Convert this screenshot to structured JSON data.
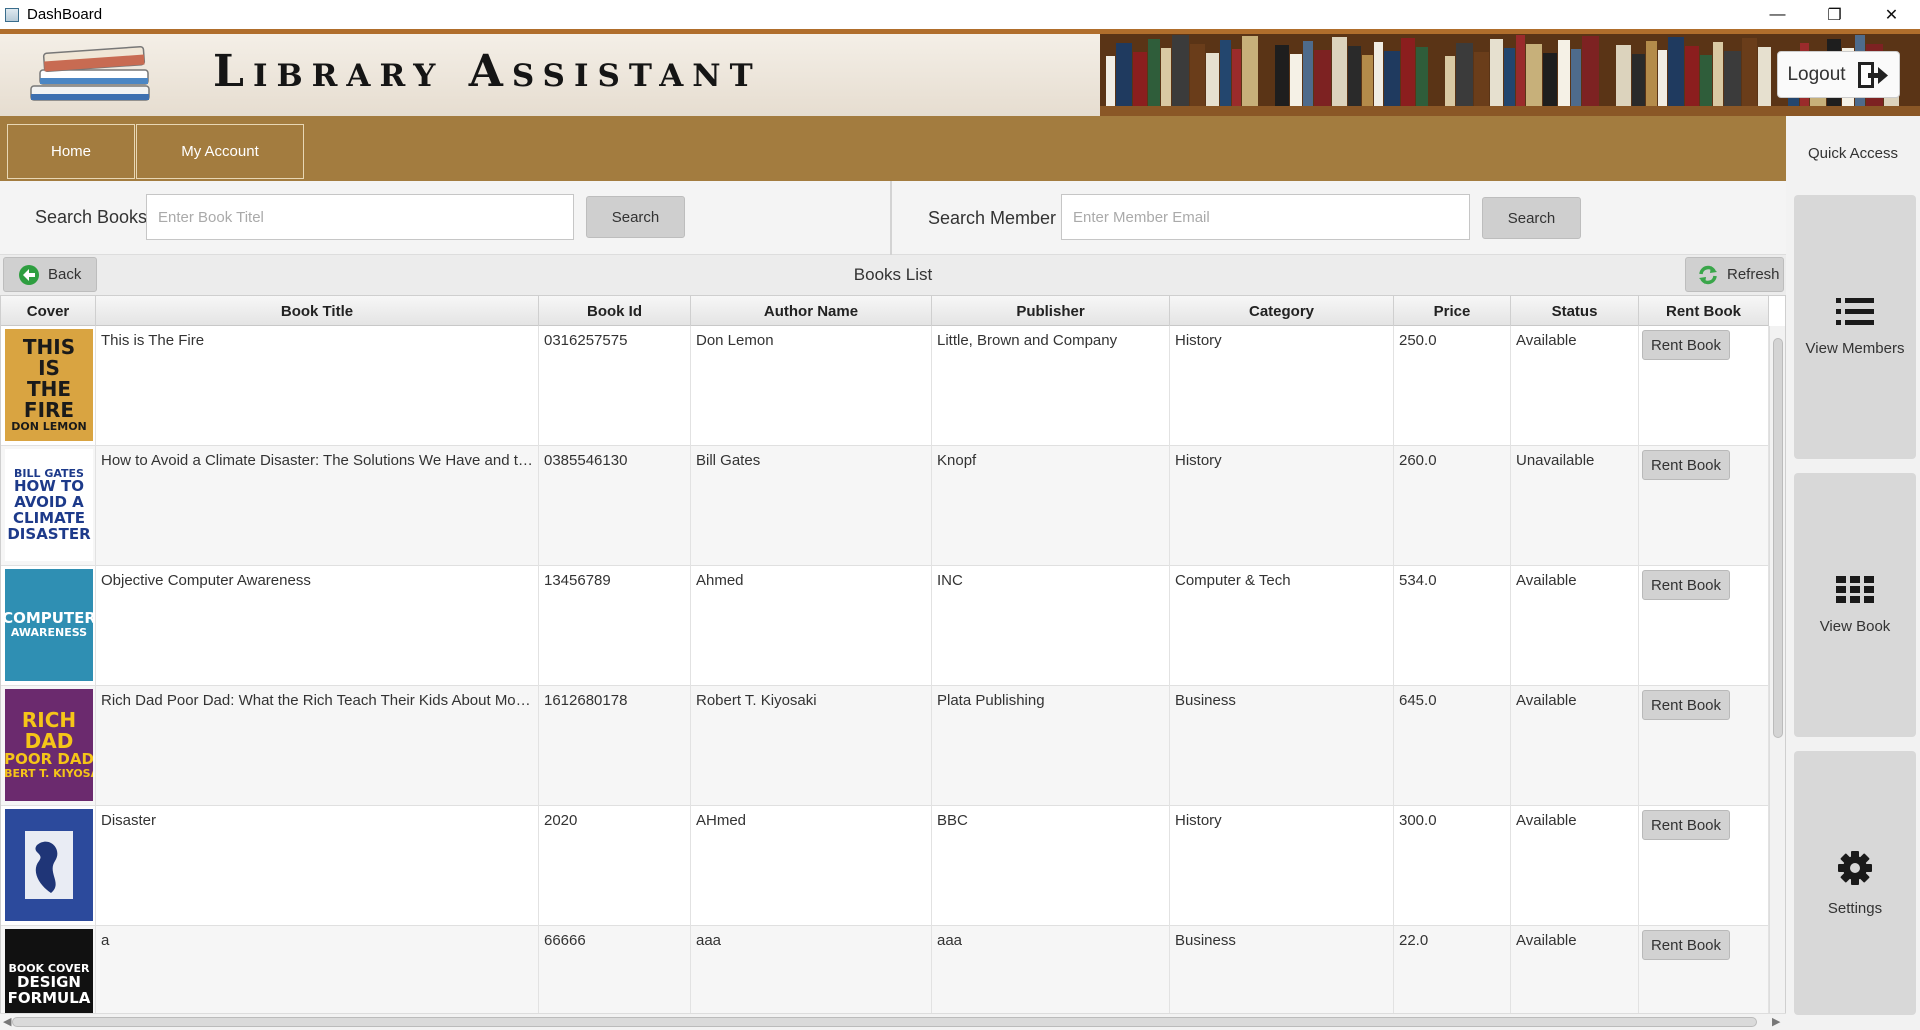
{
  "window": {
    "title": "DashBoard",
    "minimize_glyph": "—",
    "restore_glyph": "❐",
    "close_glyph": "✕"
  },
  "banner": {
    "title": "Library Assistant",
    "logout_label": "Logout"
  },
  "nav": {
    "tabs": [
      {
        "label": "Home"
      },
      {
        "label": "My Account"
      }
    ]
  },
  "sidebar": {
    "title": "Quick Access",
    "items": [
      {
        "label": "View Members",
        "icon": "list-icon"
      },
      {
        "label": "View Book",
        "icon": "grid-icon"
      },
      {
        "label": "Settings",
        "icon": "gear-icon"
      }
    ]
  },
  "search": {
    "books_label": "Search Books",
    "books_placeholder": "Enter Book Titel",
    "books_button": "Search",
    "member_label": "Search Member",
    "member_placeholder": "Enter Member Email",
    "member_button": "Search"
  },
  "list": {
    "back_label": "Back",
    "title": "Books List",
    "refresh_label": "Refresh"
  },
  "table": {
    "columns": [
      "Cover",
      "Book Title",
      "Book Id",
      "Author Name",
      "Publisher",
      "Category",
      "Price",
      "Status",
      "Rent Book"
    ],
    "rent_label": "Rent Book",
    "rows": [
      {
        "cover": {
          "lines": [
            "THIS",
            "IS",
            "THE",
            "FIRE",
            "DON LEMON"
          ],
          "bg": "#d9a441",
          "fg": "#1a1a1a"
        },
        "title": "This is The Fire",
        "id": "0316257575",
        "author": "Don Lemon",
        "publisher": "Little, Brown and Company",
        "category": "History",
        "price": "250.0",
        "status": "Available"
      },
      {
        "cover": {
          "lines": [
            "BILL GATES",
            "HOW TO",
            "AVOID A",
            "CLIMATE",
            "DISASTER"
          ],
          "bg": "#ffffff",
          "fg": "#1d3a8a"
        },
        "title": "How to Avoid a Climate Disaster: The Solutions We Have and th...",
        "id": "0385546130",
        "author": "Bill Gates",
        "publisher": "Knopf",
        "category": "History",
        "price": "260.0",
        "status": "Unavailable"
      },
      {
        "cover": {
          "lines": [
            "COMPUTER",
            "AWARENESS"
          ],
          "bg": "#2f8fb3",
          "fg": "#ffffff"
        },
        "title": "Objective Computer Awareness",
        "id": "13456789",
        "author": "Ahmed",
        "publisher": "INC",
        "category": "Computer & Tech",
        "price": "534.0",
        "status": "Available"
      },
      {
        "cover": {
          "lines": [
            "RICH",
            "DAD",
            "POOR DAD",
            "ROBERT T. KIYOSAKI"
          ],
          "bg": "#6b2a6e",
          "fg": "#f5c518"
        },
        "title": "Rich Dad Poor Dad: What the Rich Teach Their Kids About Mon...",
        "id": "1612680178",
        "author": "Robert T. Kiyosaki",
        "publisher": "Plata Publishing",
        "category": "Business",
        "price": "645.0",
        "status": "Available"
      },
      {
        "cover": {
          "lines": [],
          "bg": "#2c4a9c",
          "fg": "#ffffff"
        },
        "title": "Disaster",
        "id": "2020",
        "author": "AHmed",
        "publisher": "BBC",
        "category": "History",
        "price": "300.0",
        "status": "Available"
      },
      {
        "cover": {
          "lines": [
            "BOOK COVER",
            "DESIGN",
            "FORMULA"
          ],
          "bg": "#111111",
          "fg": "#ffffff"
        },
        "title": "a",
        "id": "66666",
        "author": "aaa",
        "publisher": "aaa",
        "category": "Business",
        "price": "22.0",
        "status": "Available"
      }
    ]
  },
  "colors": {
    "nav_bg": "#a37c3f",
    "banner_accent": "#b06e2c",
    "refresh_icon": "#3aa64a",
    "back_icon": "#2e9e40"
  }
}
